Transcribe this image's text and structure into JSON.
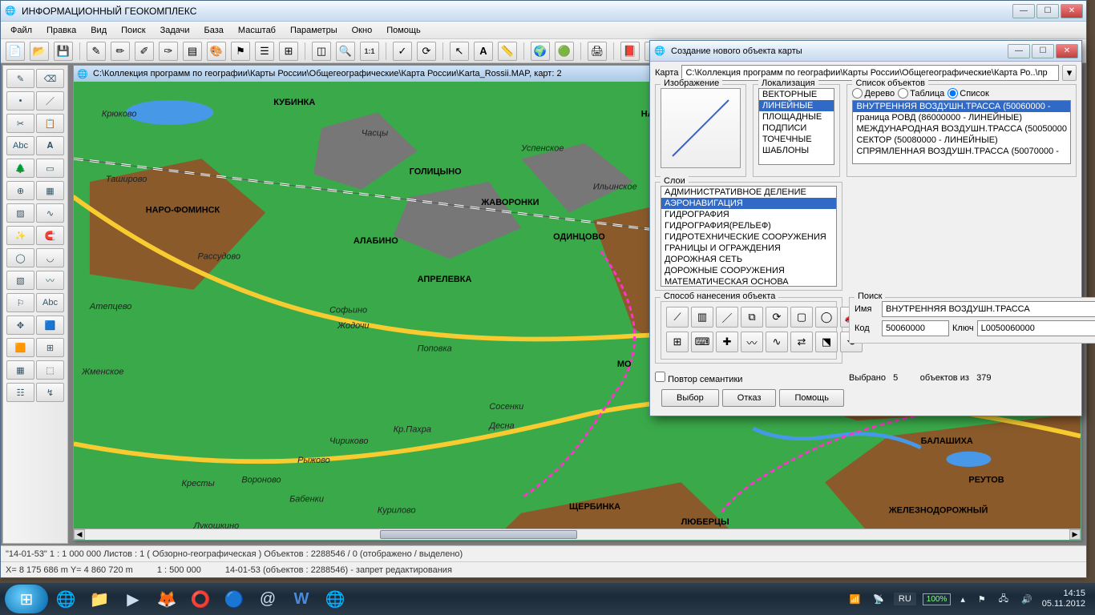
{
  "app": {
    "title": "ИНФОРМАЦИОННЫЙ ГЕОКОМПЛЕКС"
  },
  "menu": {
    "items": [
      "Файл",
      "Правка",
      "Вид",
      "Поиск",
      "Задачи",
      "База",
      "Масштаб",
      "Параметры",
      "Окно",
      "Помощь"
    ]
  },
  "child": {
    "title": "C:\\Коллекция программ по географии\\Карты России\\Общегеографические\\Карта России\\Karta_Rossii.MAP, карт: 2"
  },
  "toolbar": {
    "one_one": "1:1"
  },
  "map_labels": {
    "big": [
      "НАРО-ФОМИНСК",
      "КУБИНКА",
      "ГОЛИЦЫНО",
      "ЖАВОРОНКИ",
      "АЛАБИНО",
      "ОДИНЦОВО",
      "АПРЕЛЕВКА",
      "НАЖ",
      "МО",
      "ЩЕРБИНКА",
      "ЛЮБЕРЦЫ",
      "БАЛАШИХА",
      "РЕУТОВ",
      "ЖЕЛЕЗНОДОРОЖНЫЙ"
    ],
    "small": [
      "Крюково",
      "Таширово",
      "Рассудово",
      "Атепцево",
      "Жменское",
      "Часцы",
      "Успенское",
      "Ильинское",
      "Софьино",
      "Жодочи",
      "Поповка",
      "Сосенки",
      "Кр.Пахра",
      "Чириково",
      "Десна",
      "Рыжово",
      "Кресты",
      "Вороново",
      "Бабенки",
      "Курилово",
      "Лукошкино"
    ]
  },
  "dialog": {
    "title": "Создание нового объекта карты",
    "karta_label": "Карта",
    "karta_path": "C:\\Коллекция программ по географии\\Карты России\\Общегеографические\\Карта Ро..\\пр",
    "image_label": "Изображение",
    "local_label": "Локализация",
    "local_items": [
      "ВЕКТОРНЫЕ",
      "ЛИНЕЙНЫЕ",
      "ПЛОЩАДНЫЕ",
      "ПОДПИСИ",
      "ТОЧЕЧНЫЕ",
      "ШАБЛОНЫ"
    ],
    "local_sel": 1,
    "layers_label": "Слои",
    "layers": [
      "АДМИНИСТРАТИВНОЕ ДЕЛЕНИЕ",
      "АЭРОНАВИГАЦИЯ",
      "ГИДРОГРАФИЯ",
      "ГИДРОГРАФИЯ(РЕЛЬЕФ)",
      "ГИДРОТЕХНИЧЕСКИЕ СООРУЖЕНИЯ",
      "ГРАНИЦЫ И ОГРАЖДЕНИЯ",
      "ДОРОЖНАЯ СЕТЬ",
      "ДОРОЖНЫЕ СООРУЖЕНИЯ",
      "МАТЕМАТИЧЕСКАЯ ОСНОВА"
    ],
    "layers_sel": 1,
    "objlist_label": "Список объектов",
    "radio": {
      "tree": "Дерево",
      "table": "Таблица",
      "list": "Список"
    },
    "radio_sel": "list",
    "objects": [
      "ВНУТРЕННЯЯ ВОЗДУШН.ТРАССА (50060000 -",
      "граница РОВД (86000000 - ЛИНЕЙНЫЕ)",
      "МЕЖДУНАРОДНАЯ ВОЗДУШН.ТРАССА (50050000",
      "СЕКТОР (50080000 - ЛИНЕЙНЫЕ)",
      "СПРЯМЛЕННАЯ ВОЗДУШН.ТРАССА (50070000 -"
    ],
    "objects_sel": 0,
    "method_label": "Способ нанесения объекта",
    "repeat_label": "Повтор семантики",
    "search_label": "Поиск",
    "name_label": "Имя",
    "name_value": "ВНУТРЕННЯЯ ВОЗДУШН.ТРАССА",
    "code_label": "Код",
    "code_value": "50060000",
    "key_label": "Ключ",
    "key_value": "L0050060000",
    "selected_label": "Выбрано",
    "selected_count": "5",
    "total_label": "объектов из",
    "total_count": "379",
    "btn_choose": "Выбор",
    "btn_cancel": "Отказ",
    "btn_help": "Помощь"
  },
  "status": {
    "line1": "\"14-01-53\"  1 : 1 000 000   Листов : 1   ( Обзорно-географическая )   Объектов : 2288546 / 0 (отображено / выделено)",
    "line2_a": "X=   8 175 686 m    Y=   4 860 720 m",
    "line2_b": "1 : 500 000",
    "line2_c": "14-01-53   (объектов : 2288546) - запрет редактирования"
  },
  "taskbar": {
    "lang": "RU",
    "batt": "100%",
    "time": "14:15",
    "date": "05.11.2012"
  }
}
